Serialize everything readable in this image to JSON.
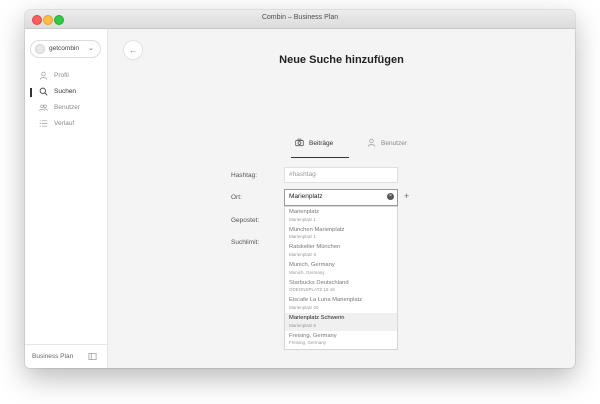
{
  "window": {
    "title": "Combin – Business Plan"
  },
  "sidebar": {
    "account_name": "getcombin",
    "items": [
      {
        "label": "Profil",
        "icon": "user-icon"
      },
      {
        "label": "Suchen",
        "icon": "search-icon"
      },
      {
        "label": "Benutzer",
        "icon": "users-icon"
      },
      {
        "label": "Verlauf",
        "icon": "list-icon"
      }
    ],
    "active_item": "Suchen",
    "plan_label": "Business Plan"
  },
  "main": {
    "title": "Neue Suche hinzufügen",
    "tabs": [
      {
        "label": "Beiträge",
        "icon": "camera-icon"
      },
      {
        "label": "Benutzer",
        "icon": "user-icon"
      }
    ],
    "form": {
      "hashtag_label": "Hashtag:",
      "hashtag_placeholder": "#hashtag",
      "ort_label": "Ort:",
      "ort_value": "Marienplatz",
      "gepostet_label": "Gepostet:",
      "suchlimit_label": "Suchlimit:"
    },
    "suggestions": [
      {
        "title": "Marienplatz",
        "subtitle": "Marienplatz 1"
      },
      {
        "title": "München Marienplatz",
        "subtitle": "Marienplatz 1"
      },
      {
        "title": "Ratskeller München",
        "subtitle": "Marienplatz 8"
      },
      {
        "title": "Munich, Germany",
        "subtitle": "Munich, Germany"
      },
      {
        "title": "Starbucks Deutschland",
        "subtitle": "ODEONSPLATZ 15-16"
      },
      {
        "title": "Eiscafe La Luna Marienplatz",
        "subtitle": "Marienplatz 20"
      },
      {
        "title": "Marienplatz Schwerin",
        "subtitle": "Marienplatz 5"
      },
      {
        "title": "Freising, Germany",
        "subtitle": "Freising, Germany"
      }
    ],
    "hovered_suggestion": "Marienplatz Schwerin"
  },
  "colors": {
    "traffic_red": "#fc605b",
    "traffic_yellow": "#fdbc40",
    "traffic_green": "#34c84a",
    "content_bg": "#f4f4f4",
    "sidebar_bg": "#ffffff",
    "text_dark": "#222222"
  }
}
